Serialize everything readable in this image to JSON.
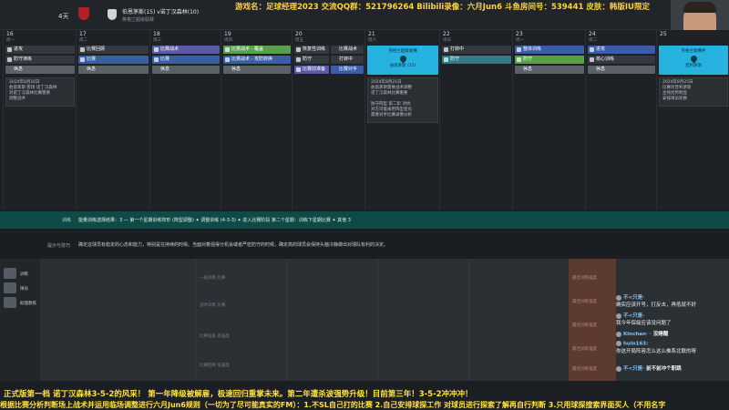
{
  "header": {
    "days": "4天",
    "match_line": "伯恩茅斯(15) v诺丁汉森林(10)",
    "match_sub": "英格兰超级联赛",
    "stream_info": "游戏名：足球经理2023  交流QQ群：521796264  Bilibili录像：六月Jun6  斗鱼房间号：539441  皮肤：韩版IU限定"
  },
  "calendar": {
    "days": [
      {
        "num": "16",
        "wd": "周一"
      },
      {
        "num": "17",
        "wd": "周二",
        "sub": "2024年8月"
      },
      {
        "num": "18",
        "wd": "周三"
      },
      {
        "num": "19",
        "wd": "周四"
      },
      {
        "num": "20",
        "wd": "周五"
      },
      {
        "num": "21",
        "wd": "周六"
      },
      {
        "num": "22",
        "wd": "周日"
      },
      {
        "num": "23",
        "wd": "周一"
      },
      {
        "num": "24",
        "wd": "周二"
      },
      {
        "num": "25",
        "wd": "周三"
      }
    ],
    "slots": {
      "d16a": "进攻",
      "d16b": "防守演练",
      "d16c": "休息",
      "d17a": "比赛回顾",
      "d17b": "比赛",
      "d17c": "休息",
      "d18a": "比赛战术",
      "d18b": "比赛",
      "d18c": "休息",
      "d19a": "比赛战术 - 覆盖",
      "d19b": "比赛战术 - 攻防转换",
      "d19c": "休息",
      "d20a": "恢复性训练",
      "d20b": "防守",
      "d20c": "比赛前准备",
      "d20d": "比赛战术",
      "d20e": "打转中",
      "d20f": "比赛对手",
      "d22a": "打转中",
      "d22b": "防守",
      "d23a": "整体训练",
      "d23b": "防守",
      "d23c": "休息",
      "d24a": "进攻",
      "d24b": "核心训练",
      "d24c": "休息",
      "d25a": "比赛",
      "d25b": "比赛战术",
      "d25c": "休息"
    },
    "match_cards": {
      "m21_title": "英格兰超级联赛",
      "m21_name": "伯恩茅斯 (15)",
      "m21_side": "主场",
      "m25_title": "英格兰联赛杯",
      "m25_name": "普利茅斯",
      "m25_side": "主场"
    },
    "notes": {
      "n16": "2024年8月16日\n伯恩茅斯 客场 诺丁汉森林\n对诺丁汉森林比赛需要\n调整战术",
      "n21": "2024年8月21日\n伯恩茅斯需要战术调整\n诺丁汉森林比赛重要\n\n防守阵型 第二轮 对抗\n对方可能采用阵型变化\n需要对手比赛录像分析",
      "n25": "2024年8月25日\n比赛对普利茅斯\n主场优势明显\n安排球员轮换"
    }
  },
  "training_bar": {
    "label": "训练",
    "text": "能量训练选择结果：3 — 第一个星期训练阵形 (阵型调整) ✦ 调整训练 (4-3-3) ✦ 进入比赛阶段  第二个星期：训练下星期比赛 ✦ 其他 3"
  },
  "tips_row": {
    "label": "提示与技巧",
    "text": "确定这球员有稳定的心态和能力，特别是在持续的时候。当面对着强得分机会或者严密防守的时候，确定高的球员会保持头脑冷静做出对球队有利的决定。"
  },
  "lower": {
    "left_items": [
      "训练",
      "球员",
      "助理教练"
    ],
    "rows": [
      "一般训练 比赛",
      "战术训练 比赛",
      "比赛准备 高强度",
      "比赛回顾 低强度"
    ],
    "orange_rows": [
      "最佳训练强度",
      "最佳训练强度",
      "最佳训练强度",
      "最佳训练强度",
      "最佳训练强度"
    ]
  },
  "chat": [
    {
      "name": "不<只是·",
      "text": "确实应该开号，打反击，再低就不好"
    },
    {
      "name": "不<只是·",
      "text": "我今年保级应该没问题了"
    },
    {
      "name": "Kinchan· ·",
      "text": "没睡醒"
    },
    {
      "name": "huln163:",
      "text": "你这开局阵容怎么这么佛系北联的呀"
    },
    {
      "name": "不<只是·",
      "text": "前不前冲个职跳"
    }
  ],
  "subtitles": {
    "line1": "正式版第一档 诺丁汉森林3-5-2的风采！ 第一年降级被解雇，极速回归重掌未来。第二年遭杀波强势升级！目前第三年！3-5-2冲冲冲！",
    "line2": "根据比赛分析判断场上战术并运用临场调整进行六月Jun6规则（一切为了尽可能真实的FM）：1.不SL自己打的比赛 2.自己安排球探工作 对球员进行探索了解再自行判断 3.只用球探搜索界面买人（不用名字"
  },
  "colors": {
    "accent_yellow": "#ffe23a",
    "match_cyan": "#26b3e0",
    "training_green": "#0f4b46"
  }
}
